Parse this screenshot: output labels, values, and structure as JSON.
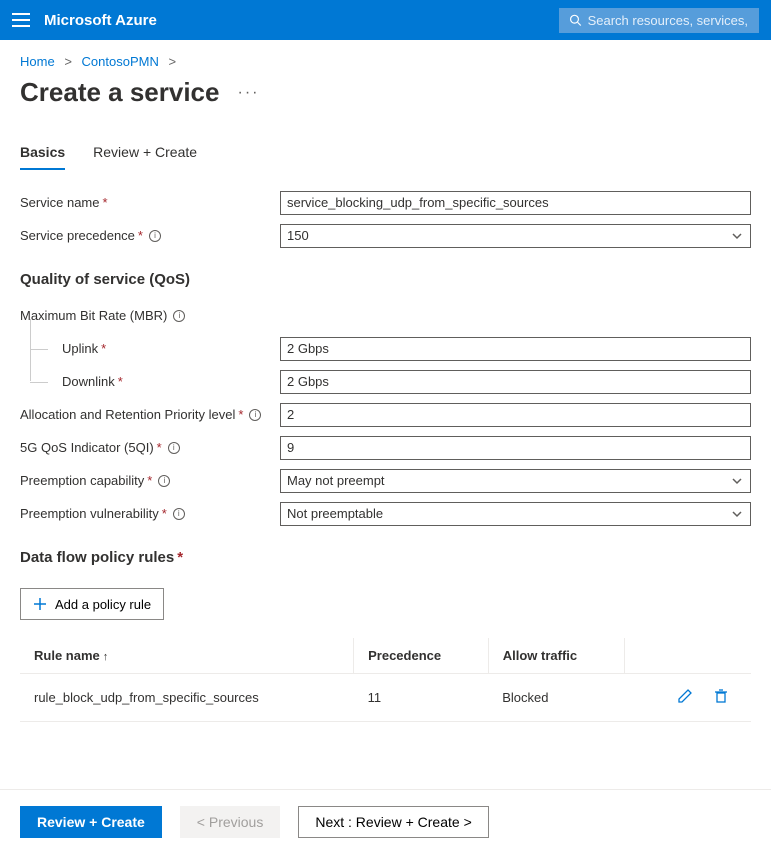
{
  "topbar": {
    "brand": "Microsoft Azure",
    "search_placeholder": "Search resources, services, and"
  },
  "breadcrumbs": {
    "home": "Home",
    "contoso": "ContosoPMN"
  },
  "page": {
    "title": "Create a service"
  },
  "tabs": {
    "basics": "Basics",
    "review": "Review + Create"
  },
  "fields": {
    "service_name": {
      "label": "Service name",
      "value": "service_blocking_udp_from_specific_sources"
    },
    "precedence": {
      "label": "Service precedence",
      "value": "150"
    },
    "qos_heading": "Quality of service (QoS)",
    "mbr_label": "Maximum Bit Rate (MBR)",
    "uplink": {
      "label": "Uplink",
      "value": "2 Gbps"
    },
    "downlink": {
      "label": "Downlink",
      "value": "2 Gbps"
    },
    "arp": {
      "label": "Allocation and Retention Priority level",
      "value": "2"
    },
    "fqi": {
      "label": "5G QoS Indicator (5QI)",
      "value": "9"
    },
    "preempt_cap": {
      "label": "Preemption capability",
      "value": "May not preempt"
    },
    "preempt_vuln": {
      "label": "Preemption vulnerability",
      "value": "Not preemptable"
    },
    "flow_heading": "Data flow policy rules",
    "add_rule": "Add a policy rule"
  },
  "table": {
    "cols": {
      "rule": "Rule name",
      "prec": "Precedence",
      "allow": "Allow traffic"
    },
    "rows": [
      {
        "rule": "rule_block_udp_from_specific_sources",
        "prec": "11",
        "allow": "Blocked"
      }
    ]
  },
  "footer": {
    "review": "Review + Create",
    "prev": "< Previous",
    "next": "Next : Review + Create >"
  }
}
